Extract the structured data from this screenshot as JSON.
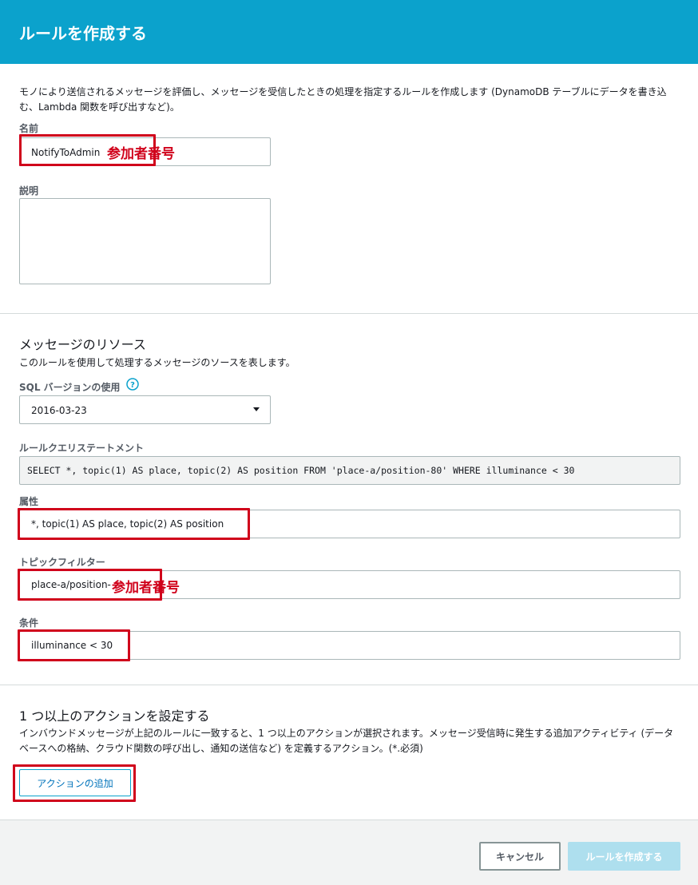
{
  "header": {
    "title": "ルールを作成する"
  },
  "intro": {
    "text": "モノにより送信されるメッセージを評価し、メッセージを受信したときの処理を指定するルールを作成します (DynamoDB テーブルにデータを書き込む、Lambda 関数を呼び出すなど)。"
  },
  "name_field": {
    "label": "名前",
    "value": "NotifyToAdmin",
    "annotation": "参加者番号"
  },
  "description_field": {
    "label": "説明",
    "value": ""
  },
  "message_source": {
    "title": "メッセージのリソース",
    "description": "このルールを使用して処理するメッセージのソースを表します。",
    "sql_version_label": "SQL バージョンの使用",
    "sql_version_value": "2016-03-23",
    "query_label": "ルールクエリステートメント",
    "query_value": "SELECT *, topic(1) AS place, topic(2) AS position FROM 'place-a/position-80' WHERE illuminance < 30",
    "attribute_label": "属性",
    "attribute_value": "*, topic(1) AS place, topic(2) AS position",
    "topic_filter_label": "トピックフィルター",
    "topic_filter_value": "place-a/position-",
    "topic_filter_annotation": "参加者番号",
    "condition_label": "条件",
    "condition_value": "illuminance < 30"
  },
  "actions": {
    "title": "1 つ以上のアクションを設定する",
    "description": "インバウンドメッセージが上記のルールに一致すると、1 つ以上のアクションが選択されます。メッセージ受信時に発生する追加アクティビティ (データベースへの格納、クラウド関数の呼び出し、通知の送信など) を定義するアクション。(*.必須)",
    "add_button": "アクションの追加"
  },
  "footer": {
    "cancel_button": "キャンセル",
    "create_button": "ルールを作成する"
  },
  "colors": {
    "header": "#0ba2cc",
    "highlight": "#d0021b",
    "primary_disabled": "#aedfee"
  }
}
